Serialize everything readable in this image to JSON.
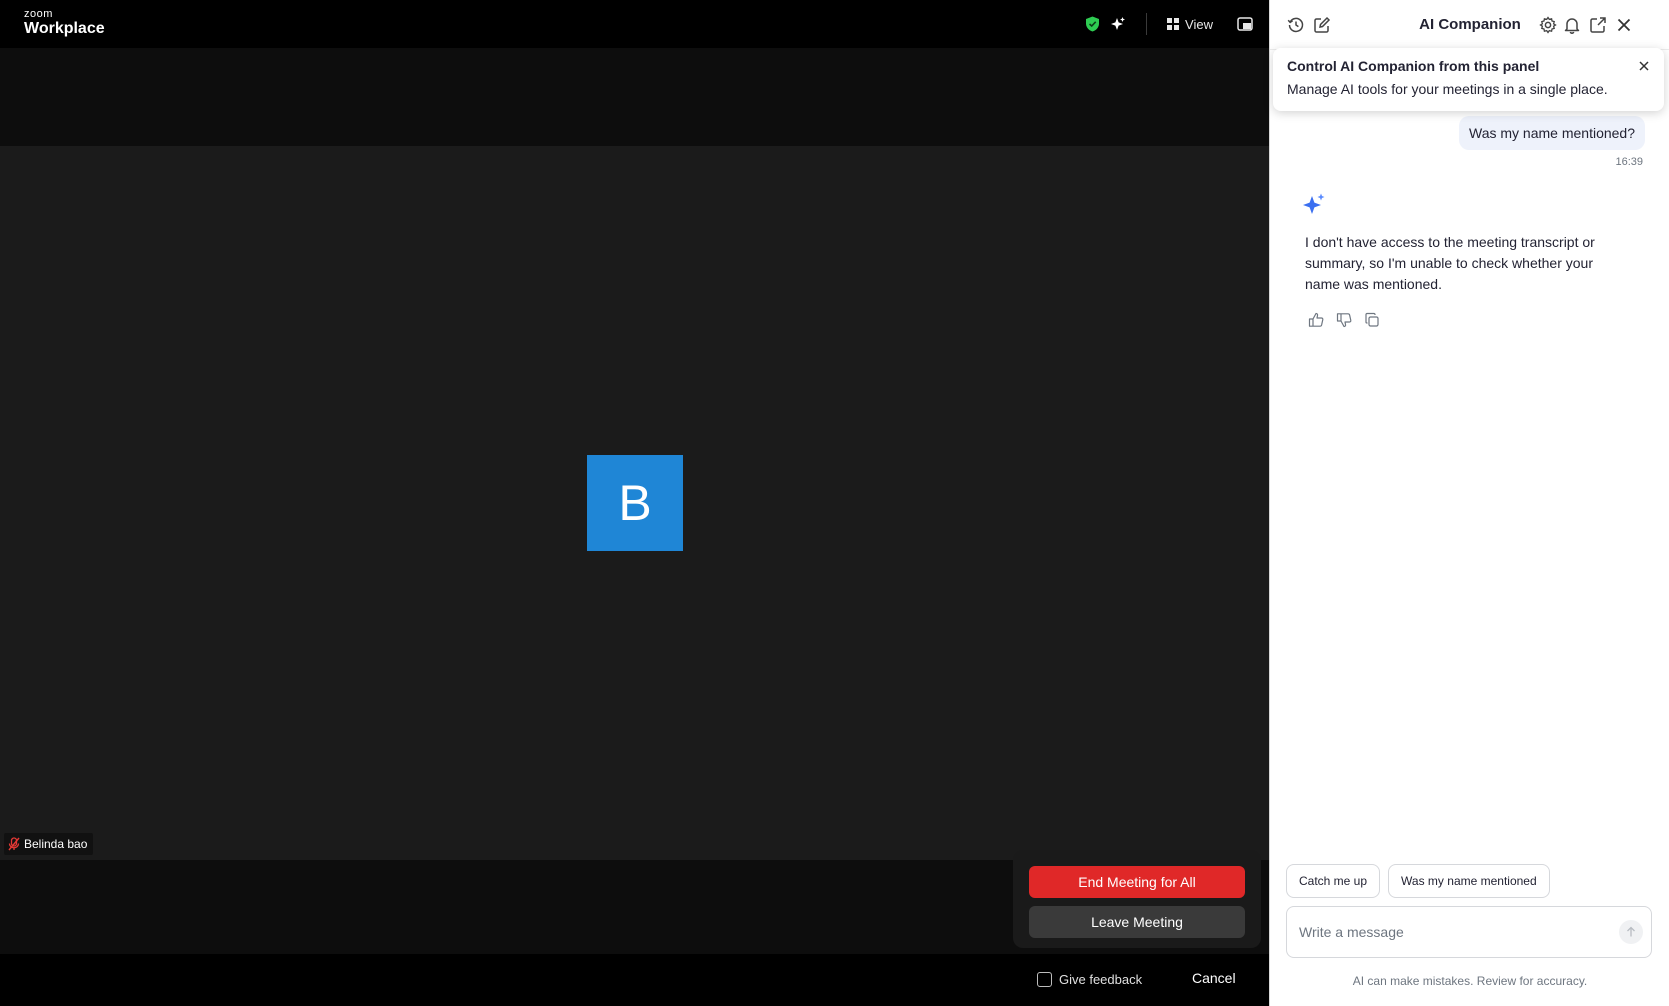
{
  "meeting": {
    "logo": {
      "brand": "zoom",
      "product": "Workplace"
    },
    "topbar": {
      "view_label": "View"
    },
    "participant": {
      "initial": "B",
      "name": "Belinda bao"
    },
    "end_dialog": {
      "end_all_label": "End Meeting for All",
      "leave_label": "Leave Meeting",
      "feedback_label": "Give feedback",
      "cancel_label": "Cancel"
    }
  },
  "panel": {
    "title": "AI Companion",
    "tooltip": {
      "title": "Control AI Companion from this panel",
      "body": "Manage AI tools for your meetings in a single place."
    },
    "conversation": {
      "user_message": "Was my name mentioned?",
      "user_time": "16:39",
      "ai_response": "I don't have access to the meeting transcript or summary, so I'm unable to check whether your name was mentioned."
    },
    "suggestions": [
      "Catch me up",
      "Was my name mentioned"
    ],
    "composer": {
      "placeholder": "Write a message"
    },
    "disclaimer": "AI can make mistakes. Review for accuracy."
  },
  "colors": {
    "end_button": "#e02828",
    "avatar": "#1f86d6",
    "shield": "#2ecc52",
    "ai_spark": "#3b6ff0"
  },
  "icons": [
    "shield-check-icon",
    "sparkle-icon",
    "grid-view-icon",
    "minimize-window-icon",
    "history-icon",
    "new-chat-icon",
    "settings-icon",
    "bell-icon",
    "pop-out-icon",
    "close-icon",
    "mic-muted-icon",
    "thumbs-up-icon",
    "thumbs-down-icon",
    "copy-icon",
    "send-icon"
  ]
}
